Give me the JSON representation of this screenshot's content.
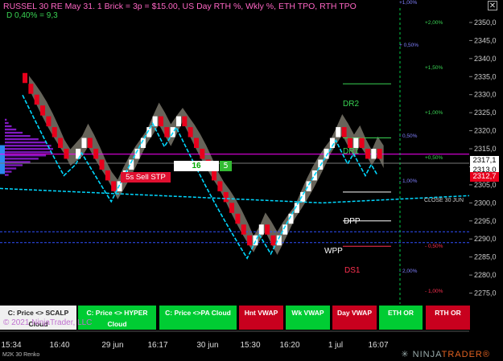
{
  "title": "RUSSEL 30 RE May 31. 1 Brick = 3p = $15.00, US Day RTH %, Wkly %, ETH TPO, RTH TPO",
  "subtitle": "D 0,40% = 9,3",
  "copyright": "© 2021 NinjaTrader, LLC",
  "instrument": "M2K 30 Renko",
  "brand": {
    "prefix": "✳ NINJA",
    "suffix": "TRADER®"
  },
  "close_icon": "✕",
  "colors": {
    "up": "#ffffff",
    "down": "#e8001c",
    "cloud": "#8a8578",
    "vwap": "#00d8ff",
    "accent_green": "#00ff44",
    "text_pink": "#ff66c4"
  },
  "buttons": [
    {
      "label": "C: Price <> SCALP Cloud",
      "style": "white"
    },
    {
      "label": "C: Price <> HYPER Cloud",
      "style": "green"
    },
    {
      "label": "C: Price <>PA Cloud",
      "style": "green"
    },
    {
      "label": "Hnt VWAP",
      "style": "red"
    },
    {
      "label": "Wk VWAP",
      "style": "green"
    },
    {
      "label": "Day VWAP",
      "style": "red"
    },
    {
      "label": "ETH OR",
      "style": "green"
    },
    {
      "label": "RTH OR",
      "style": "red"
    }
  ],
  "overlays": {
    "sell_stp": "5s  Sell STP",
    "box_16": "16",
    "box_5": "5",
    "dr2": "DR2",
    "dr1": "DR1",
    "dpp": "DPP",
    "wpp": "WPP",
    "ds1": "DS1",
    "close_label": "CLOSE 30 JUN"
  },
  "price_tags": [
    {
      "label": "2317,1",
      "style": "white"
    },
    {
      "label": "2313,0",
      "style": "white"
    },
    {
      "label": "2312,7",
      "style": "red"
    }
  ],
  "pct_labels": [
    {
      "label": "+1,00%",
      "color": "#8080ff"
    },
    {
      "label": "+2,00%",
      "color": "#39d353"
    },
    {
      "label": "+ 0,50%",
      "color": "#8080ff"
    },
    {
      "label": "+1,50%",
      "color": "#39d353"
    },
    {
      "label": "+1,00%",
      "color": "#39d353"
    },
    {
      "label": "- 0,50%",
      "color": "#8080ff"
    },
    {
      "label": "+0,50%",
      "color": "#39d353"
    },
    {
      "label": "- 1,00%",
      "color": "#8080ff"
    },
    {
      "label": "- 0,50%",
      "color": "#ff3050"
    },
    {
      "label": "- 2,00%",
      "color": "#8080ff"
    },
    {
      "label": "- 1,00%",
      "color": "#ff3050"
    }
  ],
  "chart_data": {
    "type": "renko",
    "brick_size": 3,
    "y_axis": {
      "ticks": [
        2275,
        2280,
        2285,
        2290,
        2295,
        2300,
        2305,
        2310,
        2315,
        2320,
        2325,
        2330,
        2335,
        2340,
        2345,
        2350
      ],
      "tick_labels": [
        "2275,0",
        "2280,0",
        "2285,0",
        "2290,0",
        "2295,0",
        "2300,0",
        "2305,0",
        "2310,0",
        "2315,0",
        "2320,0",
        "2325,0",
        "2330,0",
        "2335,0",
        "2340,0",
        "2345,0",
        "2350,0"
      ],
      "ylim": [
        2272,
        2354
      ]
    },
    "x_axis": {
      "tick_labels": [
        "15:34",
        "16:40",
        "29 jun",
        "16:17",
        "30 jun",
        "15:30",
        "16:20",
        "1 jul",
        "16:07"
      ]
    },
    "bricks": [
      {
        "x": 6,
        "close": 2333,
        "dir": "down"
      },
      {
        "x": 8,
        "close": 2330,
        "dir": "down"
      },
      {
        "x": 10,
        "close": 2327,
        "dir": "down"
      },
      {
        "x": 12,
        "close": 2324,
        "dir": "down"
      },
      {
        "x": 14,
        "close": 2321,
        "dir": "down"
      },
      {
        "x": 16,
        "close": 2318,
        "dir": "down"
      },
      {
        "x": 18,
        "close": 2315,
        "dir": "down"
      },
      {
        "x": 20,
        "close": 2312,
        "dir": "down"
      },
      {
        "x": 24,
        "close": 2315,
        "dir": "up"
      },
      {
        "x": 26,
        "close": 2318,
        "dir": "up"
      },
      {
        "x": 28,
        "close": 2315,
        "dir": "down"
      },
      {
        "x": 30,
        "close": 2312,
        "dir": "down"
      },
      {
        "x": 32,
        "close": 2309,
        "dir": "down"
      },
      {
        "x": 34,
        "close": 2306,
        "dir": "down"
      },
      {
        "x": 36,
        "close": 2303,
        "dir": "down"
      },
      {
        "x": 38,
        "close": 2306,
        "dir": "up"
      },
      {
        "x": 40,
        "close": 2309,
        "dir": "up"
      },
      {
        "x": 42,
        "close": 2312,
        "dir": "up"
      },
      {
        "x": 44,
        "close": 2315,
        "dir": "up"
      },
      {
        "x": 46,
        "close": 2318,
        "dir": "up"
      },
      {
        "x": 48,
        "close": 2321,
        "dir": "up"
      },
      {
        "x": 50,
        "close": 2324,
        "dir": "up"
      },
      {
        "x": 52,
        "close": 2321,
        "dir": "down"
      },
      {
        "x": 54,
        "close": 2318,
        "dir": "down"
      },
      {
        "x": 56,
        "close": 2321,
        "dir": "up"
      },
      {
        "x": 58,
        "close": 2324,
        "dir": "up"
      },
      {
        "x": 60,
        "close": 2321,
        "dir": "down"
      },
      {
        "x": 62,
        "close": 2318,
        "dir": "down"
      },
      {
        "x": 64,
        "close": 2315,
        "dir": "down"
      },
      {
        "x": 66,
        "close": 2312,
        "dir": "down"
      },
      {
        "x": 68,
        "close": 2309,
        "dir": "down"
      },
      {
        "x": 70,
        "close": 2306,
        "dir": "down"
      },
      {
        "x": 72,
        "close": 2303,
        "dir": "down"
      },
      {
        "x": 74,
        "close": 2300,
        "dir": "down"
      },
      {
        "x": 76,
        "close": 2297,
        "dir": "down"
      },
      {
        "x": 78,
        "close": 2294,
        "dir": "down"
      },
      {
        "x": 80,
        "close": 2291,
        "dir": "down"
      },
      {
        "x": 82,
        "close": 2288,
        "dir": "down"
      },
      {
        "x": 84,
        "close": 2291,
        "dir": "up"
      },
      {
        "x": 86,
        "close": 2294,
        "dir": "up"
      },
      {
        "x": 88,
        "close": 2291,
        "dir": "down"
      },
      {
        "x": 90,
        "close": 2288,
        "dir": "down"
      },
      {
        "x": 92,
        "close": 2291,
        "dir": "up"
      },
      {
        "x": 94,
        "close": 2294,
        "dir": "up"
      },
      {
        "x": 96,
        "close": 2297,
        "dir": "up"
      },
      {
        "x": 98,
        "close": 2300,
        "dir": "up"
      },
      {
        "x": 100,
        "close": 2303,
        "dir": "up"
      },
      {
        "x": 102,
        "close": 2306,
        "dir": "up"
      },
      {
        "x": 104,
        "close": 2309,
        "dir": "up"
      },
      {
        "x": 106,
        "close": 2312,
        "dir": "up"
      },
      {
        "x": 108,
        "close": 2315,
        "dir": "up"
      },
      {
        "x": 110,
        "close": 2318,
        "dir": "up"
      },
      {
        "x": 112,
        "close": 2321,
        "dir": "up"
      },
      {
        "x": 114,
        "close": 2318,
        "dir": "down"
      },
      {
        "x": 116,
        "close": 2315,
        "dir": "down"
      },
      {
        "x": 118,
        "close": 2318,
        "dir": "up"
      },
      {
        "x": 120,
        "close": 2315,
        "dir": "down"
      },
      {
        "x": 122,
        "close": 2312,
        "dir": "down"
      },
      {
        "x": 124,
        "close": 2315,
        "dir": "up"
      },
      {
        "x": 126,
        "close": 2312,
        "dir": "down"
      }
    ],
    "levels": [
      {
        "name": "DR2",
        "value": 2333
      },
      {
        "name": "DR1",
        "value": 2318
      },
      {
        "name": "DPP",
        "value": 2303
      },
      {
        "name": "WPP",
        "value": 2295
      },
      {
        "name": "DS1",
        "value": 2288
      }
    ],
    "last_price": 2317.1
  }
}
